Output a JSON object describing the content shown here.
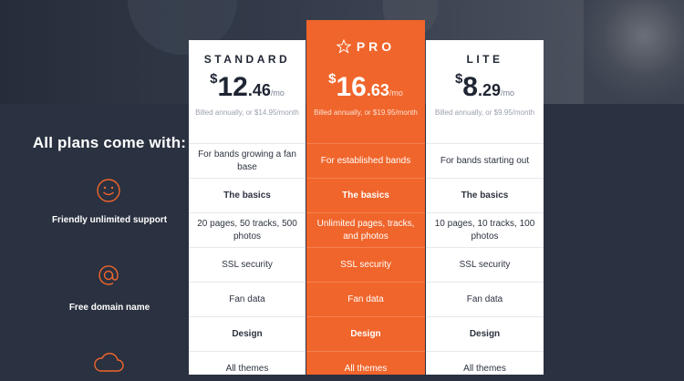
{
  "sidebar": {
    "title": "All plans come with:",
    "features": [
      {
        "label": "Friendly unlimited support",
        "icon": "smiley-icon"
      },
      {
        "label": "Free domain name",
        "icon": "at-sign-icon"
      },
      {
        "label": "",
        "icon": "cloud-icon"
      }
    ]
  },
  "plans": [
    {
      "name": "STANDARD",
      "price_currency": "$",
      "price_int": "12",
      "price_dec": ".46",
      "price_period": "/mo",
      "billed": "Billed annually, or $14.95/month",
      "rows": [
        "For bands growing a fan base",
        "The basics",
        "20 pages, 50 tracks, 500 photos",
        "SSL security",
        "Fan data",
        "Design",
        "All themes"
      ]
    },
    {
      "name": "PRO",
      "price_currency": "$",
      "price_int": "16",
      "price_dec": ".63",
      "price_period": "/mo",
      "billed": "Billed annually, or $19.95/month",
      "rows": [
        "For established bands",
        "The basics",
        "Unlimited pages, tracks, and photos",
        "SSL security",
        "Fan data",
        "Design",
        "All themes"
      ]
    },
    {
      "name": "LITE",
      "price_currency": "$",
      "price_int": "8",
      "price_dec": ".29",
      "price_period": "/mo",
      "billed": "Billed annually, or $9.95/month",
      "rows": [
        "For bands starting out",
        "The basics",
        "10 pages, 10 tracks, 100 photos",
        "SSL security",
        "Fan data",
        "Design",
        "All themes"
      ]
    }
  ],
  "colors": {
    "accent": "#f0652b",
    "dark": "#2a3140",
    "text": "#1f2533"
  }
}
